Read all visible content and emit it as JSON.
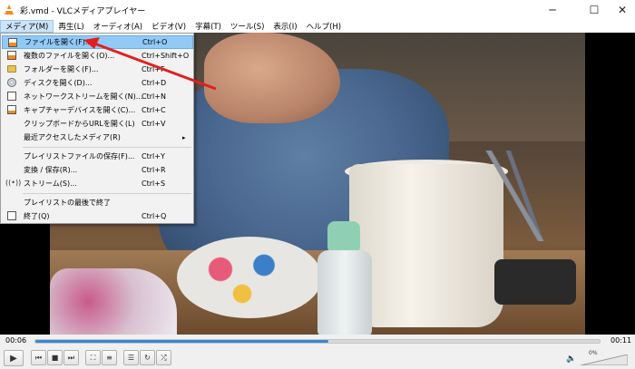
{
  "window": {
    "title": "彩.vmd - VLCメディアプレイヤー",
    "min_icon": "minimize-icon",
    "max_icon": "maximize-icon",
    "close_icon": "close-icon"
  },
  "menubar": {
    "items": [
      {
        "label": "メディア(M)"
      },
      {
        "label": "再生(L)"
      },
      {
        "label": "オーディオ(A)"
      },
      {
        "label": "ビデオ(V)"
      },
      {
        "label": "字幕(T)"
      },
      {
        "label": "ツール(S)"
      },
      {
        "label": "表示(I)"
      },
      {
        "label": "ヘルプ(H)"
      }
    ]
  },
  "media_menu": {
    "items": [
      {
        "label": "ファイルを開く(F)...",
        "shortcut": "Ctrl+O",
        "icon": "open-file-icon"
      },
      {
        "label": "複数のファイルを開く(O)...",
        "shortcut": "Ctrl+Shift+O",
        "icon": "open-multiple-files-icon"
      },
      {
        "label": "フォルダーを開く(F)...",
        "shortcut": "Ctrl+F",
        "icon": "folder-icon"
      },
      {
        "label": "ディスクを開く(D)...",
        "shortcut": "Ctrl+D",
        "icon": "disc-icon"
      },
      {
        "label": "ネットワークストリームを開く(N)...",
        "shortcut": "Ctrl+N",
        "icon": "network-icon"
      },
      {
        "label": "キャプチャーデバイスを開く(C)...",
        "shortcut": "Ctrl+C",
        "icon": "capture-device-icon"
      },
      {
        "label": "クリップボードからURLを開く(L)",
        "shortcut": "Ctrl+V",
        "icon": ""
      },
      {
        "label": "最近アクセスしたメディア(R)",
        "shortcut": "",
        "icon": ""
      },
      {
        "label": "プレイリストファイルの保存(F)...",
        "shortcut": "Ctrl+Y",
        "icon": ""
      },
      {
        "label": "変換 / 保存(R)...",
        "shortcut": "Ctrl+R",
        "icon": ""
      },
      {
        "label": "ストリーム(S)...",
        "shortcut": "Ctrl+S",
        "icon": "stream-icon"
      },
      {
        "label": "プレイリストの最後で終了",
        "shortcut": "",
        "icon": ""
      },
      {
        "label": "終了(Q)",
        "shortcut": "Ctrl+Q",
        "icon": "exit-icon"
      }
    ],
    "submenu_arrow": "▸"
  },
  "player": {
    "time_current": "00:06",
    "time_total": "00:11",
    "progress": 0.52,
    "volume_percent": "0%"
  },
  "colors": {
    "menu_highlight": "#91c9f7",
    "seek_fill": "#3a86d6",
    "annotation_arrow": "#e02020"
  }
}
